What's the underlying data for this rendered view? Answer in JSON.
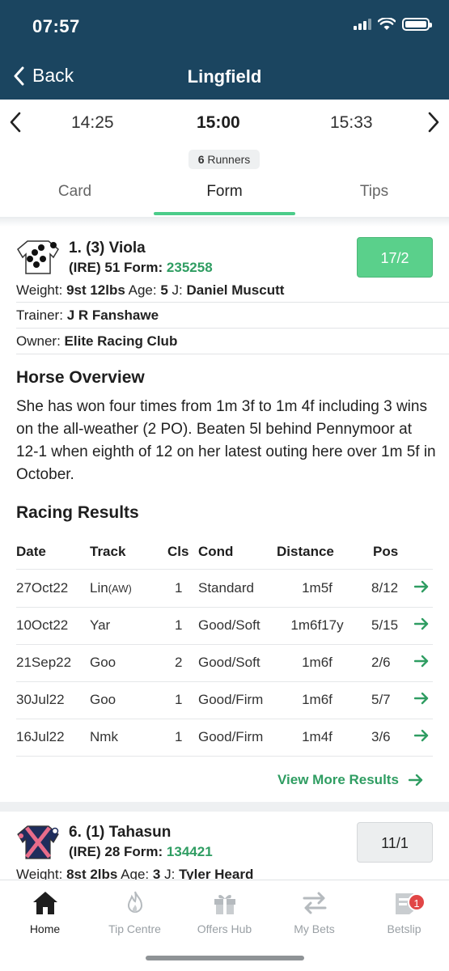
{
  "status_bar": {
    "time": "07:57"
  },
  "nav_header": {
    "back_label": "Back",
    "title": "Lingfield"
  },
  "races": {
    "prev_time": "14:25",
    "current_time": "15:00",
    "next_time": "15:33"
  },
  "runners_count": {
    "number": "6",
    "label": "Runners"
  },
  "tabs": [
    {
      "label": "Card"
    },
    {
      "label": "Form"
    },
    {
      "label": "Tips"
    }
  ],
  "runner1": {
    "name": "1. (3) Viola",
    "meta_prefix": "(IRE) 51 Form:",
    "form": "235258",
    "odds": "17/2",
    "weight_label": "Weight:",
    "weight": "9st 12lbs",
    "age_label": "Age:",
    "age": "5",
    "jockey_label": "J:",
    "jockey": "Daniel Muscutt",
    "trainer_label": "Trainer:",
    "trainer": "J R Fanshawe",
    "owner_label": "Owner:",
    "owner": "Elite Racing Club"
  },
  "overview": {
    "title": "Horse Overview",
    "text": "She has won four times from 1m 3f to 1m 4f including 3 wins on the all-weather (2 PO). Beaten 5l behind Pennymoor at 12-1 when eighth of 12 on her latest outing here over 1m 5f in October."
  },
  "results": {
    "title": "Racing Results",
    "headers": {
      "date": "Date",
      "track": "Track",
      "cls": "Cls",
      "cond": "Cond",
      "distance": "Distance",
      "pos": "Pos"
    },
    "rows": [
      {
        "date": "27Oct22",
        "track": "Lin",
        "track_suffix": "(AW)",
        "cls": "1",
        "cond": "Standard",
        "distance": "1m5f",
        "pos": "8/12"
      },
      {
        "date": "10Oct22",
        "track": "Yar",
        "track_suffix": "",
        "cls": "1",
        "cond": "Good/Soft",
        "distance": "1m6f17y",
        "pos": "5/15"
      },
      {
        "date": "21Sep22",
        "track": "Goo",
        "track_suffix": "",
        "cls": "2",
        "cond": "Good/Soft",
        "distance": "1m6f",
        "pos": "2/6"
      },
      {
        "date": "30Jul22",
        "track": "Goo",
        "track_suffix": "",
        "cls": "1",
        "cond": "Good/Firm",
        "distance": "1m6f",
        "pos": "5/7"
      },
      {
        "date": "16Jul22",
        "track": "Nmk",
        "track_suffix": "",
        "cls": "1",
        "cond": "Good/Firm",
        "distance": "1m4f",
        "pos": "3/6"
      }
    ],
    "view_more": "View More Results"
  },
  "runner2": {
    "name": "6. (1) Tahasun",
    "meta_prefix": "(IRE) 28 Form:",
    "form": "134421",
    "odds": "11/1",
    "weight_label": "Weight:",
    "weight": "8st 2lbs",
    "age_label": "Age:",
    "age": "3",
    "jockey_label": "J:",
    "jockey": "Tyler Heard"
  },
  "bottom_nav": [
    {
      "label": "Home",
      "icon": "home-icon"
    },
    {
      "label": "Tip Centre",
      "icon": "flame-icon"
    },
    {
      "label": "Offers Hub",
      "icon": "gift-icon"
    },
    {
      "label": "My Bets",
      "icon": "swap-arrows-icon"
    },
    {
      "label": "Betslip",
      "icon": "betslip-icon",
      "badge": "1"
    }
  ],
  "colors": {
    "header_bg": "#1b4560",
    "accent_green": "#4ccc8a",
    "form_green": "#2f9d62",
    "badge_red": "#e14646"
  }
}
